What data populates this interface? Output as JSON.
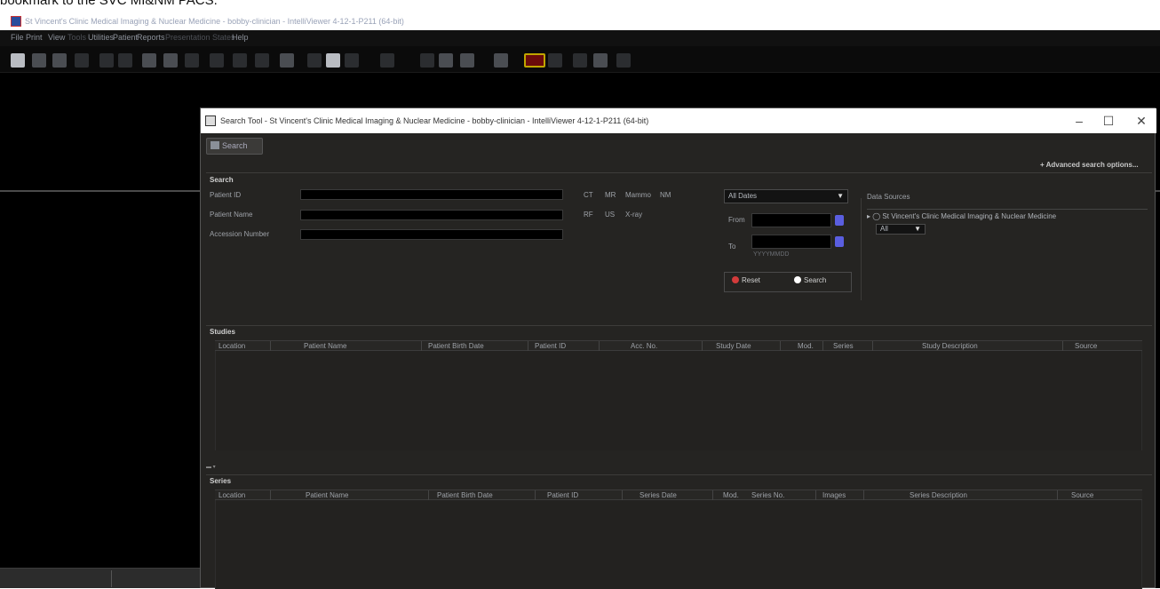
{
  "caption": "bookmark to the SVC MI&NM PACS.",
  "main_window": {
    "title": "St Vincent's Clinic Medical Imaging & Nuclear Medicine - bobby-clinician - IntelliViewer 4-12-1-P211 (64-bit)"
  },
  "menubar": {
    "items": [
      {
        "label": "File",
        "enabled": true
      },
      {
        "label": "Print",
        "enabled": true
      },
      {
        "label": "View",
        "enabled": true
      },
      {
        "label": "Tools",
        "enabled": false
      },
      {
        "label": "Utilities",
        "enabled": true
      },
      {
        "label": "Patient",
        "enabled": true
      },
      {
        "label": "Reports",
        "enabled": true
      },
      {
        "label": "Presentation States",
        "enabled": false
      },
      {
        "label": "Help",
        "enabled": true
      }
    ]
  },
  "dialog": {
    "title": "Search Tool - St Vincent's Clinic Medical Imaging & Nuclear Medicine - bobby-clinician - IntelliViewer 4-12-1-P211 (64-bit)",
    "controls": {
      "minimize": "–",
      "maximize": "☐",
      "close": "✕"
    },
    "tab_label": "Search",
    "advanced_link": "+ Advanced search options..."
  },
  "search": {
    "section_label": "Search",
    "fields": {
      "patient_id": {
        "label": "Patient ID",
        "value": ""
      },
      "patient_name": {
        "label": "Patient Name",
        "value": ""
      },
      "accession_number": {
        "label": "Accession Number",
        "value": ""
      }
    },
    "modalities": [
      "CT",
      "MR",
      "Mammo",
      "NM",
      "RF",
      "US",
      "X-ray"
    ],
    "date_select": {
      "value": "All Dates"
    },
    "from_label": "From",
    "to_label": "To",
    "date_hint": "YYYYMMDD",
    "reset_label": "Reset",
    "search_label": "Search",
    "data_sources": {
      "label": "Data Sources",
      "source": "St Vincent's Clinic Medical Imaging & Nuclear Medicine",
      "sub_select": "All"
    }
  },
  "studies": {
    "section_label": "Studies",
    "columns": [
      "Location",
      "Patient Name",
      "Patient Birth Date",
      "Patient ID",
      "Acc. No.",
      "Study Date",
      "Mod.",
      "Series",
      "Study Description",
      "Source"
    ],
    "rows": []
  },
  "series": {
    "section_label": "Series",
    "columns": [
      "Location",
      "Patient Name",
      "Patient Birth Date",
      "Patient ID",
      "Series Date",
      "Mod.",
      "Series No.",
      "Images",
      "Series Description",
      "Source"
    ],
    "rows": []
  },
  "colors": {
    "dialog_bg": "#252422",
    "input_bg": "#000000",
    "calendar_button": "#5a5ee0",
    "reset_dot": "#d33b3b",
    "search_dot": "#ffffff"
  }
}
